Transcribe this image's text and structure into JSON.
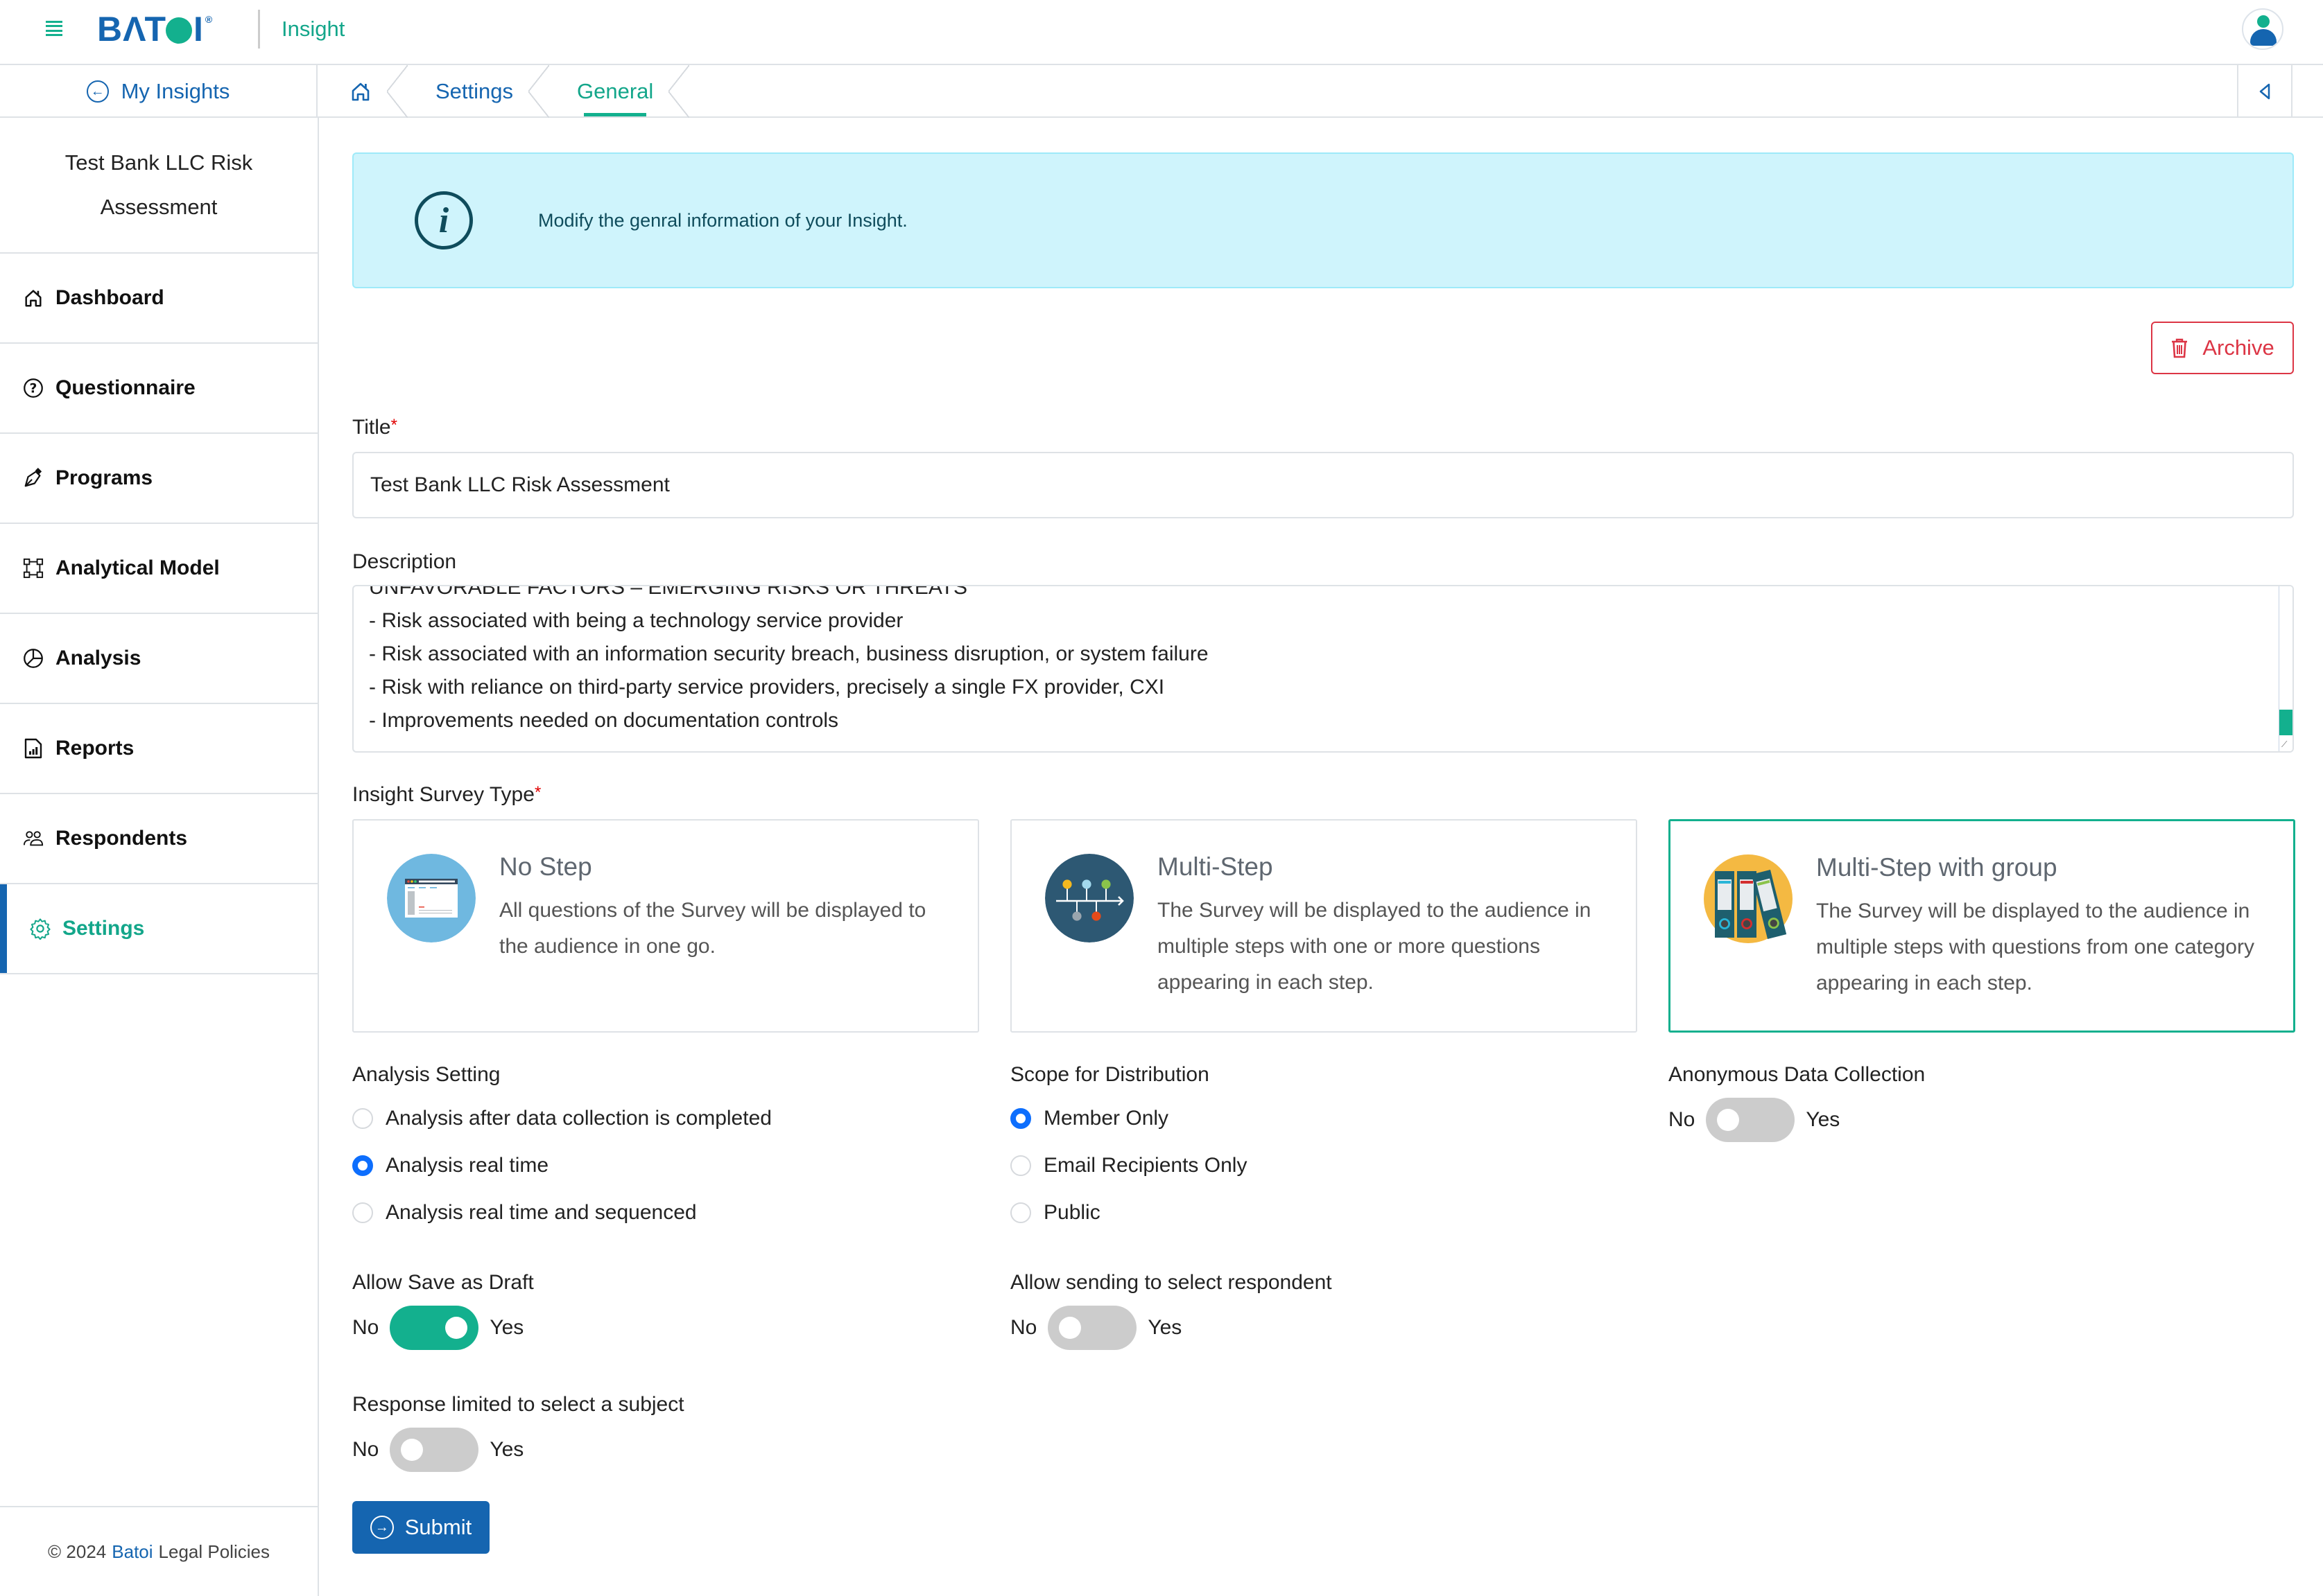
{
  "header": {
    "logo_text": "BATOI",
    "app_name": "Insight"
  },
  "subnav": {
    "back_label": "My Insights",
    "breadcrumbs": [
      {
        "label": "Settings"
      },
      {
        "label": "General",
        "active": true
      }
    ]
  },
  "sidebar": {
    "insight_name": "Test Bank LLC Risk Assessment",
    "items": [
      {
        "label": "Dashboard",
        "icon": "home-icon"
      },
      {
        "label": "Questionnaire",
        "icon": "question-circle-icon"
      },
      {
        "label": "Programs",
        "icon": "pen-nib-icon"
      },
      {
        "label": "Analytical Model",
        "icon": "bounding-box-icon"
      },
      {
        "label": "Analysis",
        "icon": "pie-chart-icon"
      },
      {
        "label": "Reports",
        "icon": "report-file-icon"
      },
      {
        "label": "Respondents",
        "icon": "people-icon"
      },
      {
        "label": "Settings",
        "icon": "gear-icon",
        "active": true
      }
    ],
    "footer": {
      "copyright": "© 2024",
      "brand": "Batoi",
      "legal": "Legal Policies"
    }
  },
  "main": {
    "info_message": "Modify the genral information of your Insight.",
    "archive_label": "Archive",
    "title_label": "Title",
    "title_value": "Test Bank LLC Risk Assessment",
    "description_label": "Description",
    "description_lines": [
      "UNFAVORABLE FACTORS – EMERGING RISKS OR THREATS",
      "- Risk associated with being a technology service provider",
      "- Risk associated with an information security breach, business disruption, or system failure",
      "- Risk with reliance on third-party service providers, precisely a single FX provider, CXI",
      "- Improvements needed on documentation controls"
    ],
    "survey_type_label": "Insight Survey Type",
    "survey_types": [
      {
        "title": "No Step",
        "desc": "All questions of the Survey will be displayed to the audience in one go.",
        "selected": false
      },
      {
        "title": "Multi-Step",
        "desc": "The Survey will be displayed to the audience in multiple steps with one or more questions appearing in each step.",
        "selected": false
      },
      {
        "title": "Multi-Step with group",
        "desc": "The Survey will be displayed to the audience in multiple steps with questions from one category appearing in each step.",
        "selected": true
      }
    ],
    "analysis_setting": {
      "label": "Analysis Setting",
      "options": [
        {
          "label": "Analysis after data collection is completed",
          "checked": false
        },
        {
          "label": "Analysis real time",
          "checked": true
        },
        {
          "label": "Analysis real time and sequenced",
          "checked": false
        }
      ]
    },
    "scope": {
      "label": "Scope for Distribution",
      "options": [
        {
          "label": "Member Only",
          "checked": true
        },
        {
          "label": "Email Recipients Only",
          "checked": false
        },
        {
          "label": "Public",
          "checked": false
        }
      ]
    },
    "anonymous": {
      "label": "Anonymous Data Collection",
      "no": "No",
      "yes": "Yes",
      "on": false
    },
    "save_draft": {
      "label": "Allow Save as Draft",
      "no": "No",
      "yes": "Yes",
      "on": true
    },
    "select_respondent": {
      "label": "Allow sending to select respondent",
      "no": "No",
      "yes": "Yes",
      "on": false
    },
    "limit_subject": {
      "label": "Response limited to select a subject",
      "no": "No",
      "yes": "Yes",
      "on": false
    },
    "submit_label": "Submit"
  },
  "colors": {
    "brand_blue": "#1565b0",
    "accent_green": "#13b08e",
    "danger": "#dc3545",
    "info_bg": "#cff4fc",
    "radio_blue": "#0d6efd"
  }
}
